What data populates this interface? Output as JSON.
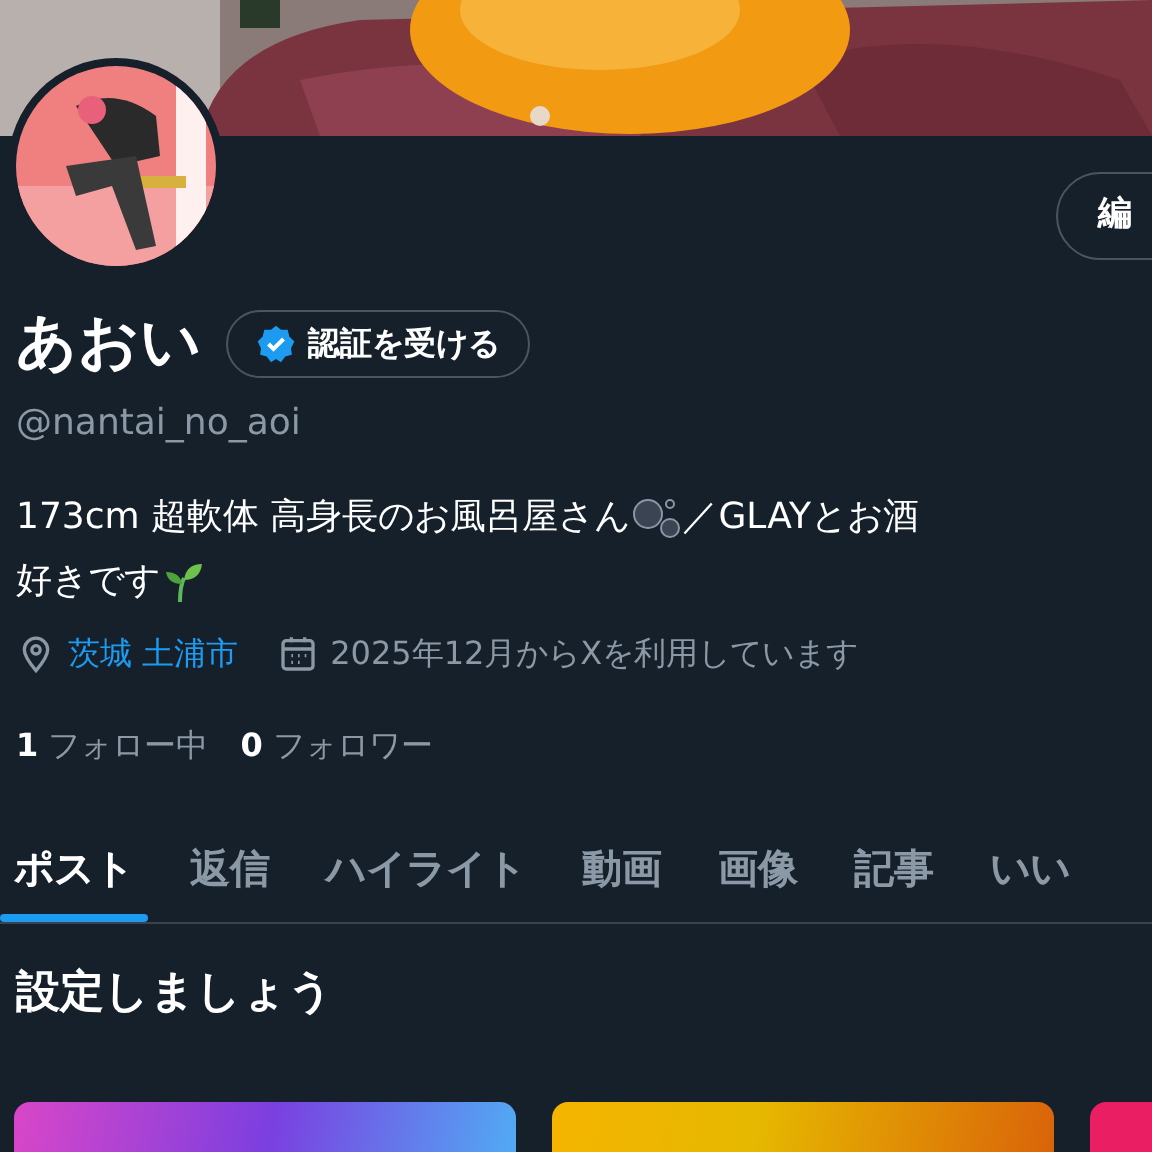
{
  "profile": {
    "edit_button": "編",
    "name": "あおい",
    "verify_button": "認証を受ける",
    "handle": "@nantai_no_aoi",
    "bio_lines": [
      {
        "parts": [
          {
            "kind": "text",
            "text": "173cm 超軟体 高身長のお風呂屋さん"
          },
          {
            "kind": "bubbles"
          },
          {
            "kind": "text",
            "text": "／GLAYとお酒"
          }
        ]
      },
      {
        "parts": [
          {
            "kind": "text",
            "text": "好きです"
          },
          {
            "kind": "sprout"
          }
        ]
      }
    ],
    "location": "茨城 土浦市",
    "joined": "2025年12月からXを利用しています",
    "stats": [
      {
        "count": "1",
        "label": "フォロー中"
      },
      {
        "count": "0",
        "label": "フォロワー"
      }
    ]
  },
  "tabs": [
    {
      "label": "ポスト",
      "selected": true
    },
    {
      "label": "返信",
      "selected": false
    },
    {
      "label": "ハイライト",
      "selected": false
    },
    {
      "label": "動画",
      "selected": false
    },
    {
      "label": "画像",
      "selected": false
    },
    {
      "label": "記事",
      "selected": false
    },
    {
      "label": "いい",
      "selected": false
    }
  ],
  "section_title": "設定しましょう",
  "cards": [
    {
      "color": "#d946c8"
    },
    {
      "color": "#f5b400"
    },
    {
      "color": "#e91e63"
    }
  ]
}
